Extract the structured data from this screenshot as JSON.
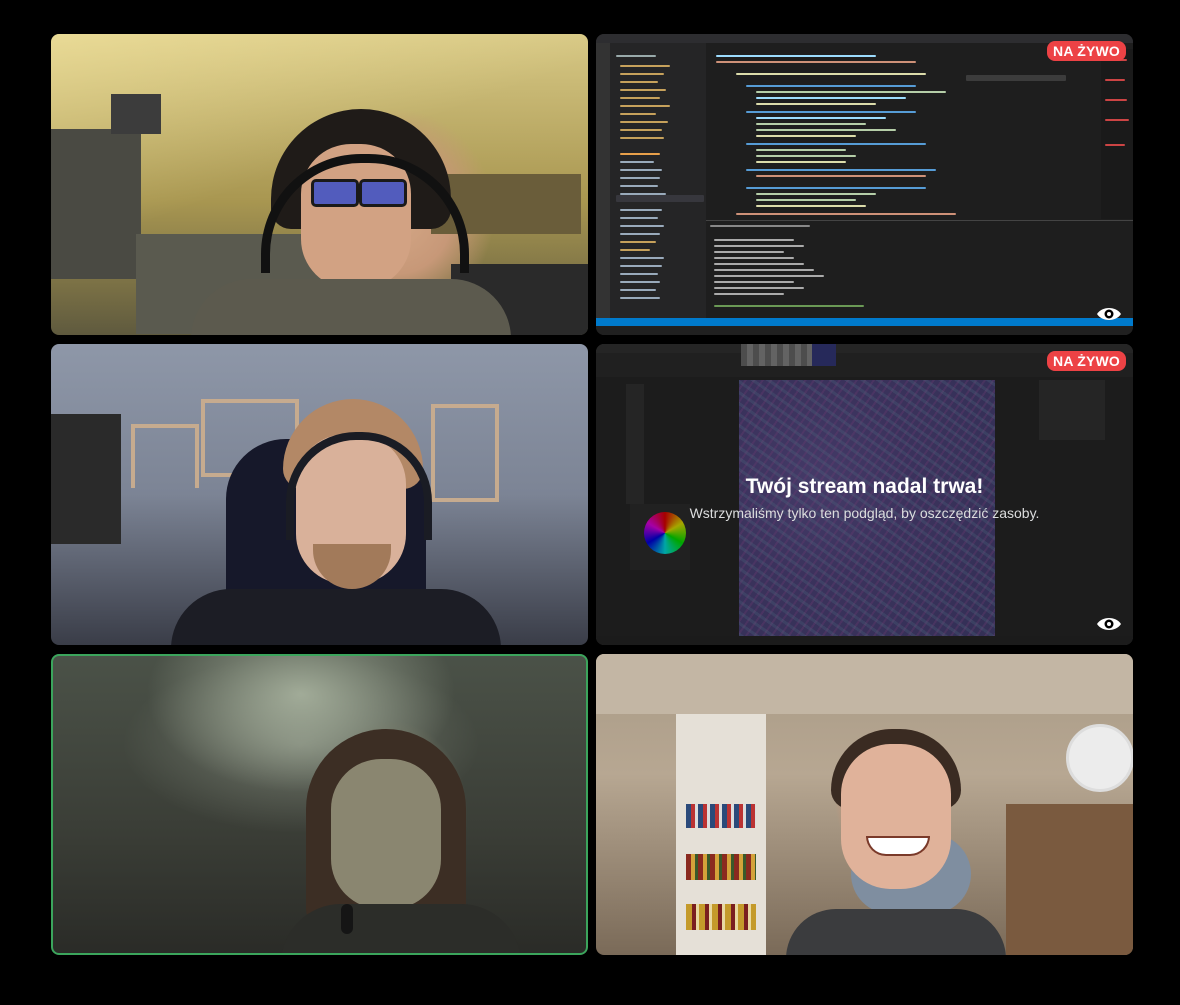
{
  "tiles": [
    {
      "id": "participant-1",
      "type": "webcam"
    },
    {
      "id": "participant-2-stream",
      "type": "screen-share",
      "live_badge": "NA ŻYWO",
      "view_icon": "eye-icon"
    },
    {
      "id": "participant-3",
      "type": "webcam"
    },
    {
      "id": "participant-4-stream",
      "type": "screen-share",
      "live_badge": "NA ŻYWO",
      "view_icon": "eye-icon",
      "paused_title": "Twój stream nadal trwa!",
      "paused_subtitle": "Wstrzymaliśmy tylko ten podgląd, by oszczędzić zasoby."
    },
    {
      "id": "participant-5",
      "type": "webcam",
      "speaking": true
    },
    {
      "id": "participant-6",
      "type": "webcam"
    }
  ],
  "colors": {
    "background": "#000000",
    "live": "#ed4245",
    "speaking": "#3ba55c"
  }
}
